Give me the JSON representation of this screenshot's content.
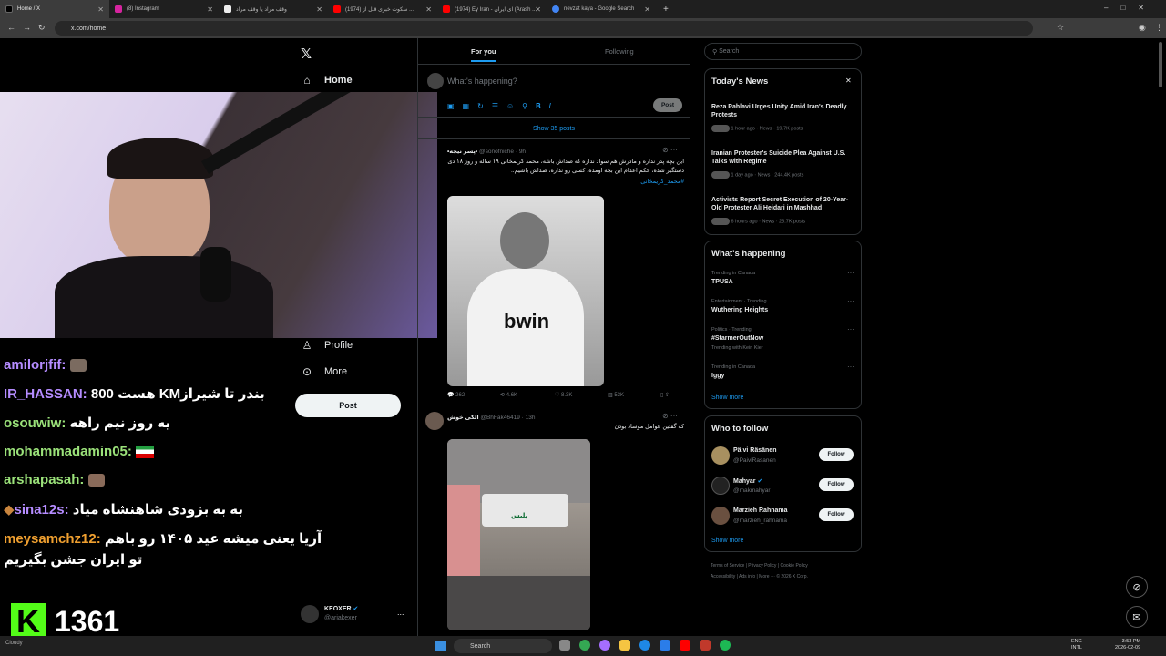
{
  "browser": {
    "tabs": [
      {
        "label": "Home / X",
        "active": true
      },
      {
        "label": "(8) Instagram"
      },
      {
        "label": "وقف مراد یا وقف مراد"
      },
      {
        "label": "(1974) سکوت خبری قبل از ..."
      },
      {
        "label": "(1974) Ey Iran - ای ایران (Arash ..."
      },
      {
        "label": "nevzat kaya - Google Search"
      }
    ],
    "new_tab": "+",
    "url": "x.com/home"
  },
  "nav": {
    "home": "Home",
    "profile": "Profile",
    "more": "More",
    "post_button": "Post",
    "account_name": "KEOXER",
    "account_handle": "@ariakexer",
    "more_dots": "..."
  },
  "feed": {
    "tabs": [
      "For you",
      "Following"
    ],
    "compose_placeholder": "What's happening?",
    "compose_post": "Post",
    "show_posts": "Show 35 posts",
    "posts": [
      {
        "name": "•پسر نیچه•",
        "handle": "@sonofniche · 9h",
        "text": "این بچه پدر نداره و مادرش هم سواد نداره که صداش باشه، محمد کریمخانی ۱۹ ساله و روز ۱۸ دی دستگیر شده، حکم اعدام این بچه اومده، کسی رو نداره، صداش باشیم..",
        "hashtag": "#محمد_کریمخانی",
        "image_text": "bwin",
        "replies": "262",
        "reposts": "4.6K",
        "likes": "8.3K",
        "views": "53K"
      },
      {
        "name": "الکی خوش",
        "handle": "@BhFak46419 · 13h",
        "text": "که گفتین عوامل موساد بودن",
        "image_text": "پلیس"
      }
    ]
  },
  "right": {
    "search_placeholder": "Search",
    "news_title": "Today's News",
    "news": [
      {
        "title": "Reza Pahlavi Urges Unity Amid Iran's Deadly Protests",
        "meta": "1 hour ago · News · 19.7K posts"
      },
      {
        "title": "Iranian Protester's Suicide Plea Against U.S. Talks with Regime",
        "meta": "1 day ago · News · 244.4K posts"
      },
      {
        "title": "Activists Report Secret Execution of 20-Year-Old Protester Ali Heidari in Mashhad",
        "meta": "6 hours ago · News · 23.7K posts"
      }
    ],
    "happening_title": "What's happening",
    "trends": [
      {
        "context": "Trending in Canada",
        "name": "TPUSA",
        "extra": ""
      },
      {
        "context": "Entertainment · Trending",
        "name": "Wuthering Heights",
        "extra": ""
      },
      {
        "context": "Politics · Trending",
        "name": "#StarmerOutNow",
        "extra": "Trending with Keir, Kier"
      },
      {
        "context": "Trending in Canada",
        "name": "Iggy",
        "extra": ""
      }
    ],
    "show_more": "Show more",
    "follow_title": "Who to follow",
    "follow": [
      {
        "name": "Päivi Räsänen",
        "handle": "@PaiviRasanen",
        "button": "Follow"
      },
      {
        "name": "Mahyar",
        "handle": "@makmahyar",
        "button": "Follow"
      },
      {
        "name": "Marzieh Rahnama",
        "handle": "@marzieh_rahnama",
        "button": "Follow"
      }
    ],
    "show_more2": "Show more",
    "footer1": "Terms of Service  |  Privacy Policy  |  Cookie Policy",
    "footer2": "Accessibility  |  Ads info  |  More ···  © 2026 X Corp."
  },
  "stream": {
    "chat": [
      {
        "user": "amilorjfif:",
        "msg": "",
        "color": "#b58cff"
      },
      {
        "user": "IR_HASSAN:",
        "msg": "800 هست KMبندر تا شیراز",
        "color": "#b58cff"
      },
      {
        "user": "osouwiw:",
        "msg": "یه روز نیم راهه",
        "color": "#9be27a"
      },
      {
        "user": "mohammadamin05:",
        "msg": "",
        "color": "#9be27a"
      },
      {
        "user": "arshapasah:",
        "msg": "",
        "color": "#9be27a"
      },
      {
        "user": "sina12s:",
        "msg": "به به بزودی شاهنشاه میاد",
        "color": "#b58cff"
      },
      {
        "user": "meysamchz12:",
        "msg": "آریا یعنی میشه عید ۱۴۰۵ رو باهم",
        "color": "#f0a030"
      },
      {
        "user": "",
        "msg": "تو ایران جشن بگیریم",
        "color": "#ffffff"
      }
    ],
    "viewer_count": "1361",
    "kick_letter": "K"
  },
  "taskbar": {
    "search": "Search",
    "lang": "ENG",
    "lang2": "INTL",
    "time": "3:53 PM",
    "date": "2026-02-09",
    "weather": "Cloudy"
  }
}
